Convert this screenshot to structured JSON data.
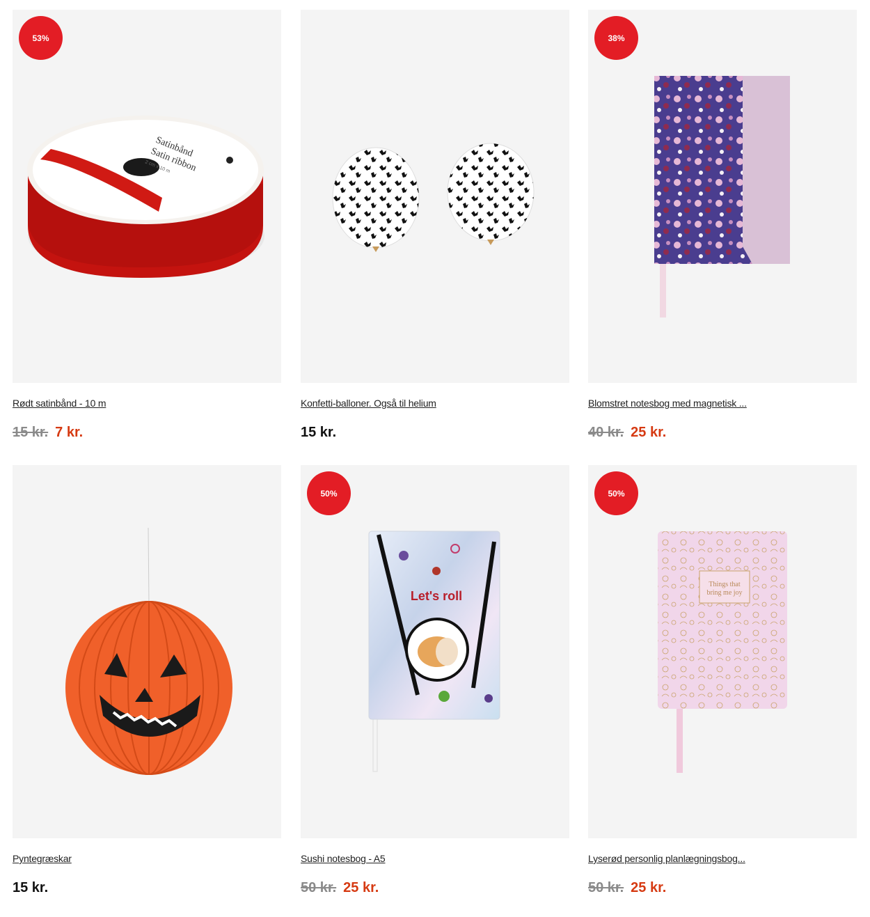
{
  "products": [
    {
      "title": "Rødt satinbånd - 10 m",
      "badge": "53%",
      "old_price": "15 kr.",
      "price": "7 kr.",
      "image": "red-satin-ribbon",
      "ribbon_text1": "Satinbånd",
      "ribbon_text2": "Satin ribbon",
      "ribbon_text3": "2 cm x 10 m"
    },
    {
      "title": "Konfetti-balloner. Også til helium",
      "price": "15 kr.",
      "image": "confetti-balloons"
    },
    {
      "title": "Blomstret notesbog med magnetisk ...",
      "badge": "38%",
      "old_price": "40 kr.",
      "price": "25 kr.",
      "image": "floral-notebook"
    },
    {
      "title": "Pyntegræskar",
      "price": "15 kr.",
      "image": "pumpkin-lantern"
    },
    {
      "title": "Sushi notesbog - A5",
      "badge": "50%",
      "old_price": "50 kr.",
      "price": "25 kr.",
      "image": "sushi-notebook",
      "cover_text": "Let's roll"
    },
    {
      "title": "Lyserød personlig planlægningsbog...",
      "badge": "50%",
      "old_price": "50 kr.",
      "price": "25 kr.",
      "image": "pink-planner",
      "cover_text1": "Things that",
      "cover_text2": "bring me joy"
    }
  ],
  "colors": {
    "sale_badge": "#e31d25",
    "sale_price": "#d63a12",
    "old_price": "#8a8a8a",
    "tile_bg": "#f4f4f4"
  }
}
